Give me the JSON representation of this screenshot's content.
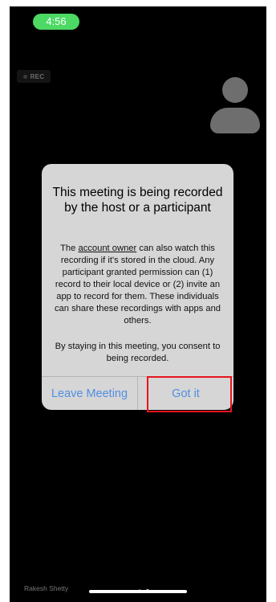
{
  "status_bar": {
    "time": "4:56"
  },
  "recording_badge": {
    "label": "REC"
  },
  "dialog": {
    "title": "This meeting is being recorded by the host or a participant",
    "body_before_link": "The ",
    "body_link": "account owner",
    "body_after_link": " can also watch this recording if it's stored in the cloud. Any participant granted permission can (1) record to their local device or (2) invite an app to record for them. These individuals can share these recordings with apps and others.",
    "consent": "By staying in this meeting, you consent to being recorded.",
    "leave_button": "Leave Meeting",
    "confirm_button": "Got it"
  },
  "participant": {
    "name": "Rakesh Shetty"
  },
  "pager": {
    "pages": 2,
    "active": 2
  },
  "colors": {
    "status_pill": "#4cd964",
    "dialog_button": "#4f8fe0",
    "highlight_border": "#e8141d"
  }
}
